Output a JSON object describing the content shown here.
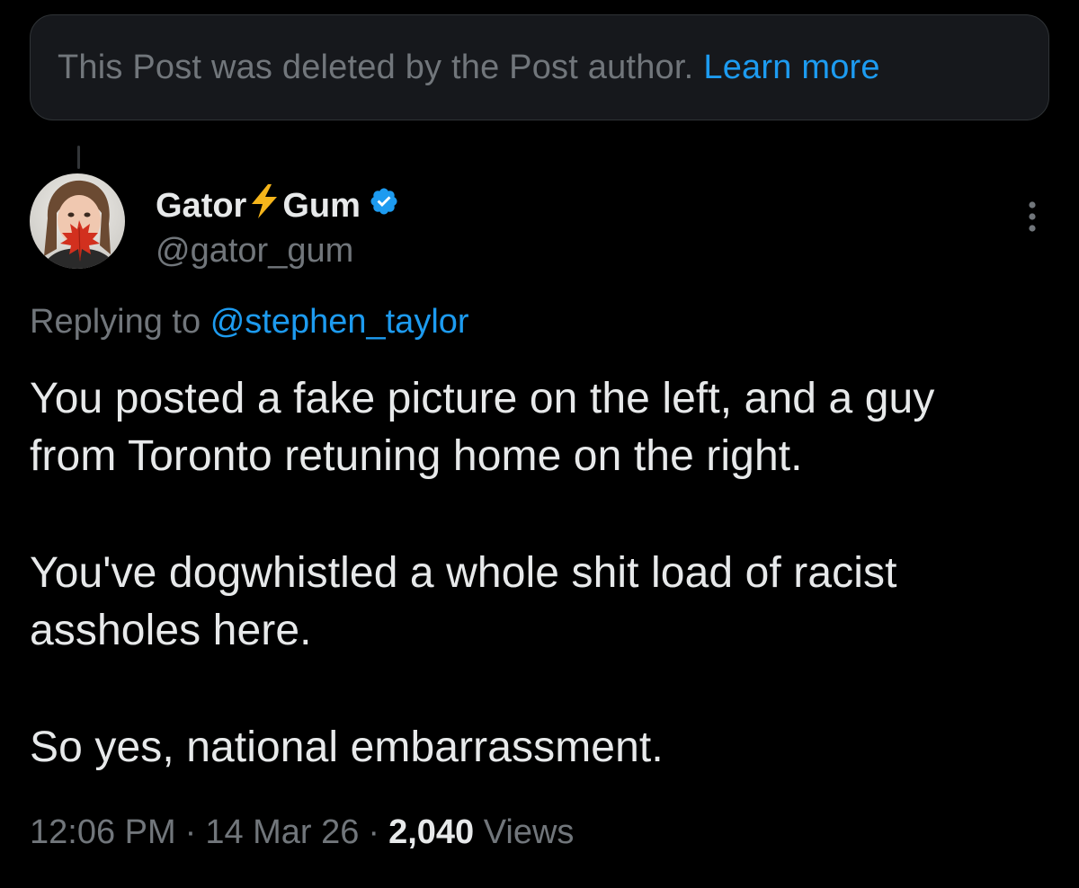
{
  "notice": {
    "text": "This Post was deleted by the Post author.",
    "link": "Learn more"
  },
  "author": {
    "name_first": "Gator",
    "name_second": "Gum",
    "name_emoji": "lightning-bolt-icon",
    "verified": true,
    "handle": "@gator_gum"
  },
  "reply": {
    "prefix": "Replying to",
    "mention": "@stephen_taylor"
  },
  "post": {
    "paragraph1_line1": "You posted a fake picture on the left, and a guy",
    "paragraph1_line2": "from Toronto retuning home on the right.",
    "paragraph2_line1": "You've dogwhistled a whole shit load of racist",
    "paragraph2_line2": "assholes here.",
    "paragraph3": "So yes, national embarrassment."
  },
  "meta": {
    "time": "12:06 PM",
    "date": "14 Mar 26",
    "views_count": "2,040",
    "views_label": "Views",
    "separator": "·"
  },
  "colors": {
    "background": "#000000",
    "text_primary": "#e7e9ea",
    "text_secondary": "#71767b",
    "accent": "#1d9bf0",
    "banner_bg": "#16181c",
    "bolt": "#f5b51b"
  }
}
